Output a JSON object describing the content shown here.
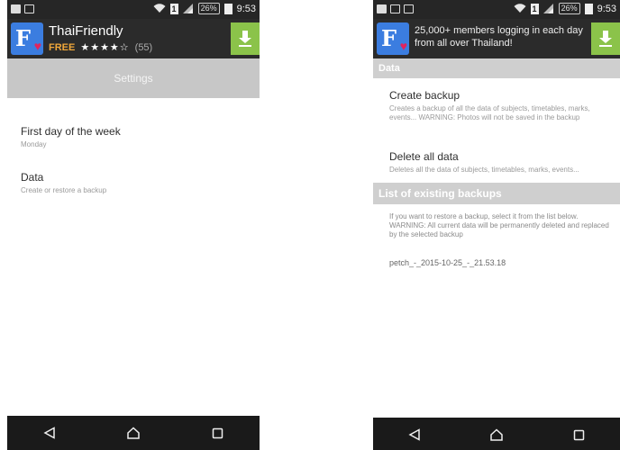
{
  "statusbar": {
    "battery": "26%",
    "sim": "1",
    "time": "9:53"
  },
  "left": {
    "ad": {
      "title": "ThaiFriendly",
      "free": "FREE",
      "stars": "★★★★☆",
      "count": "(55)"
    },
    "settings_title": "Settings",
    "prefs": [
      {
        "title": "First day of the week",
        "summary": "Monday"
      },
      {
        "title": "Data",
        "summary": "Create or restore a backup"
      }
    ]
  },
  "right": {
    "ad": {
      "tagline": "25,000+ members logging in each day from all over Thailand!"
    },
    "data_header": "Data",
    "create_backup": {
      "title": "Create backup",
      "summary": "Creates a backup of all the data of subjects, timetables, marks, events... WARNING: Photos will not be saved in the backup"
    },
    "delete_all": {
      "title": "Delete all data",
      "summary": "Deletes all the data of subjects, timetables, marks, events..."
    },
    "backups_header": "List of existing backups",
    "backups_info": "If you want to restore a backup, select it from the list below. WARNING: All current data will be permanently deleted and replaced by the selected backup",
    "backups": [
      "petch_-_2015-10-25_-_21.53.18"
    ]
  },
  "icons": {
    "download": "download-icon",
    "back": "back-triangle-icon",
    "home": "home-icon",
    "recents": "recents-square-icon",
    "wifi": "wifi-icon",
    "signal": "signal-icon",
    "logo": "thaifriendly-logo-icon"
  },
  "colors": {
    "statusbar": "#262626",
    "adbar": "#2b2b2b",
    "download_green": "#8bc34a",
    "free_orange": "#f0a73a",
    "settings_bar": "#c7c7c7",
    "section_header": "#cfcfcf",
    "navbar": "#1a1a1a"
  }
}
